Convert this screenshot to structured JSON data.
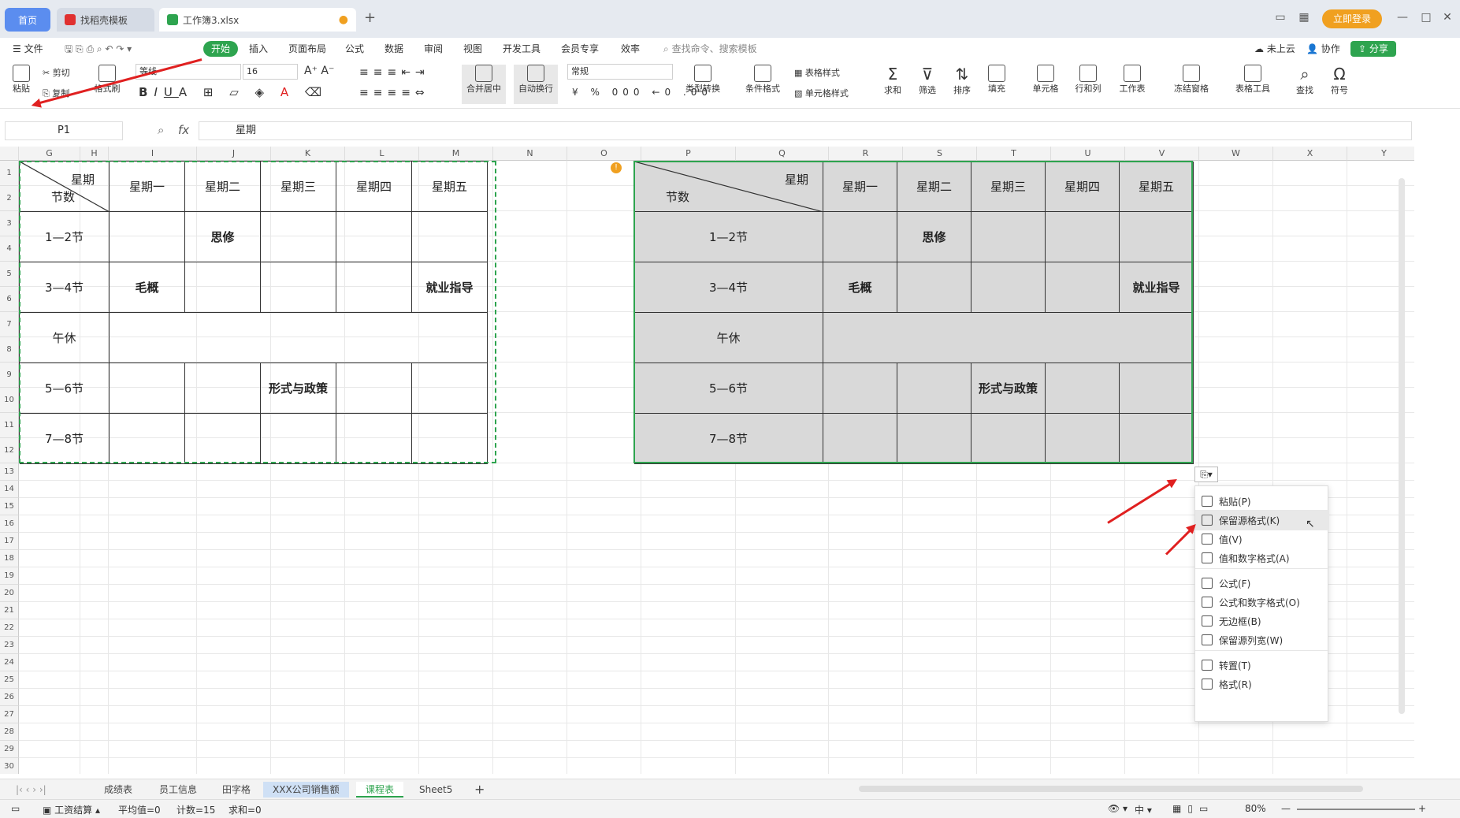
{
  "titlebar": {
    "tab_home": "首页",
    "tab_template": "找稻壳模板",
    "tab_file": "工作簿3.xlsx",
    "login": "立即登录"
  },
  "menu": {
    "file": "文件",
    "items": [
      "开始",
      "插入",
      "页面布局",
      "公式",
      "数据",
      "审阅",
      "视图",
      "开发工具",
      "会员专享",
      "效率"
    ],
    "search": "查找命令、搜索模板",
    "cloud": "未上云",
    "collab": "协作",
    "share": "分享"
  },
  "toolbar": {
    "paste": "粘贴",
    "cut": "剪切",
    "copy": "复制",
    "format_painter": "格式刷",
    "font": "等线",
    "size": "16",
    "number_format": "常规",
    "merge": "合并居中",
    "wrap": "自动换行",
    "type_convert": "类型转换",
    "cond_format": "条件格式",
    "table_style": "表格样式",
    "cell_style": "单元格样式",
    "sum": "求和",
    "filter": "筛选",
    "sort": "排序",
    "fill": "填充",
    "cell": "单元格",
    "rowcol": "行和列",
    "worksheet": "工作表",
    "freeze": "冻结窗格",
    "table_tools": "表格工具",
    "find": "查找",
    "symbol": "符号"
  },
  "formula": {
    "cellref": "P1",
    "fx": "fx",
    "value": "星期"
  },
  "columns": [
    "G",
    "H",
    "I",
    "J",
    "K",
    "L",
    "M",
    "N",
    "O",
    "P",
    "Q",
    "R",
    "S",
    "T",
    "U",
    "V",
    "W",
    "X",
    "Y"
  ],
  "rows": [
    "1",
    "2",
    "3",
    "4",
    "5",
    "6",
    "7",
    "8",
    "9",
    "10",
    "11",
    "12",
    "13",
    "14",
    "15",
    "16",
    "17",
    "18",
    "19",
    "20",
    "21",
    "22",
    "23",
    "24",
    "25",
    "26",
    "27",
    "28",
    "29",
    "30"
  ],
  "table": {
    "corner_top": "星期",
    "corner_bottom": "节数",
    "days": [
      "星期一",
      "星期二",
      "星期三",
      "星期四",
      "星期五"
    ],
    "periods": [
      "1—2节",
      "3—4节",
      "午休",
      "5—6节",
      "7—8节"
    ],
    "c_sixiu": "思修",
    "c_maogai": "毛概",
    "c_jiuye": "就业指导",
    "c_xingshi": "形式与政策"
  },
  "paste_menu": [
    "粘贴(P)",
    "保留源格式(K)",
    "值(V)",
    "值和数字格式(A)",
    "公式(F)",
    "公式和数字格式(O)",
    "无边框(B)",
    "保留源列宽(W)",
    "转置(T)",
    "格式(R)"
  ],
  "sheets": [
    "成绩表",
    "员工信息",
    "田字格",
    "XXX公司销售额",
    "课程表",
    "Sheet5"
  ],
  "status": {
    "macro": "工资结算",
    "avg": "平均值=0",
    "count": "计数=15",
    "sum": "求和=0",
    "zoom": "80%"
  }
}
